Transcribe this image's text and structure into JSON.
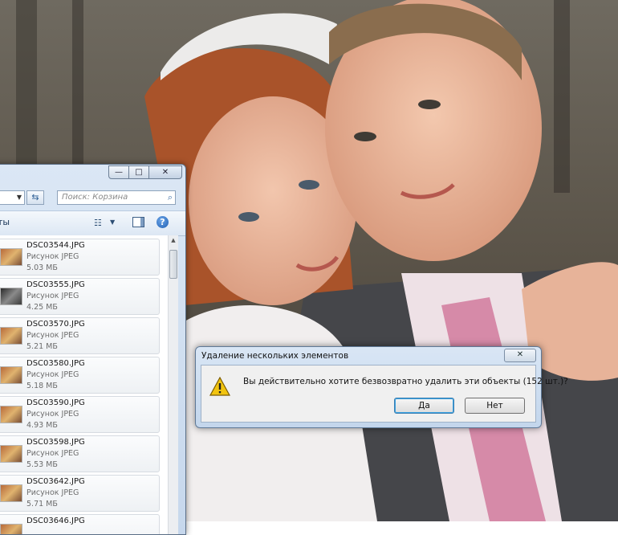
{
  "explorer": {
    "search_placeholder": "Поиск: Корзина",
    "toolbar_label": "ты",
    "controls": {
      "minimize": "—",
      "maximize": "□",
      "close": "✕"
    },
    "items": [
      {
        "name": "DSC03544.JPG",
        "type": "Рисунок JPEG",
        "size": "5.03 МБ"
      },
      {
        "name": "DSC03555.JPG",
        "type": "Рисунок JPEG",
        "size": "4.25 МБ"
      },
      {
        "name": "DSC03570.JPG",
        "type": "Рисунок JPEG",
        "size": "5.21 МБ"
      },
      {
        "name": "DSC03580.JPG",
        "type": "Рисунок JPEG",
        "size": "5.18 МБ"
      },
      {
        "name": "DSC03590.JPG",
        "type": "Рисунок JPEG",
        "size": "4.93 МБ"
      },
      {
        "name": "DSC03598.JPG",
        "type": "Рисунок JPEG",
        "size": "5.53 МБ"
      },
      {
        "name": "DSC03642.JPG",
        "type": "Рисунок JPEG",
        "size": "5.71 МБ"
      },
      {
        "name": "DSC03646.JPG",
        "type": "",
        "size": ""
      }
    ]
  },
  "dialog": {
    "title": "Удаление нескольких элементов",
    "message": "Вы действительно хотите безвозвратно удалить эти объекты (152 шт.)?",
    "yes_label": "Да",
    "no_label": "Нет",
    "close_glyph": "✕"
  },
  "icons": {
    "warning": "warning-icon",
    "search": "search-icon",
    "refresh": "refresh-icon",
    "help": "help-icon"
  },
  "colors": {
    "window_frame": "#c6d7ec",
    "accent": "#39a0e0",
    "warning": "#f2c40f"
  }
}
